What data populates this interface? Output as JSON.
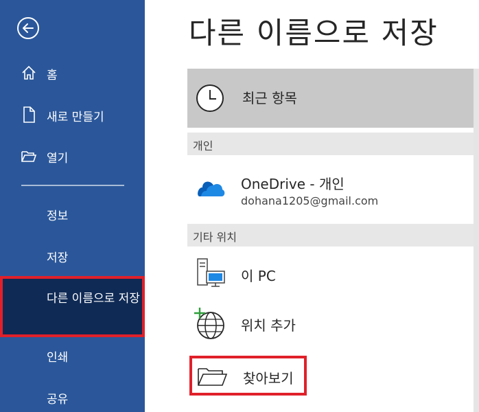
{
  "colors": {
    "sidebar": "#2b579a",
    "sidebar_active": "#0f2a55",
    "highlight_border": "#e0202a",
    "recent_bg": "#c8c8c8",
    "section_bg": "#e7e7e7"
  },
  "page": {
    "title": "다른 이름으로 저장"
  },
  "sidebar": {
    "back_icon": "back-arrow-icon",
    "items": [
      {
        "label": "홈",
        "icon": "home-icon"
      },
      {
        "label": "새로 만들기",
        "icon": "new-document-icon"
      },
      {
        "label": "열기",
        "icon": "open-folder-icon"
      }
    ],
    "sub_items": [
      {
        "label": "정보"
      },
      {
        "label": "저장"
      },
      {
        "label": "다른 이름으로 저장",
        "active": true
      },
      {
        "label": "인쇄"
      },
      {
        "label": "공유"
      }
    ]
  },
  "main": {
    "recent": {
      "label": "최근 항목",
      "icon": "clock-icon"
    },
    "sections": [
      {
        "title": "개인"
      },
      {
        "title": "기타 위치"
      }
    ],
    "locations": {
      "onedrive": {
        "name": "OneDrive - 개인",
        "account": "dohana1205@gmail.com",
        "icon": "onedrive-cloud-icon"
      },
      "this_pc": {
        "name": "이 PC",
        "icon": "computer-icon"
      },
      "add_place": {
        "name": "위치 추가",
        "icon": "globe-add-icon"
      },
      "browse": {
        "name": "찾아보기",
        "icon": "folder-browse-icon"
      }
    }
  }
}
